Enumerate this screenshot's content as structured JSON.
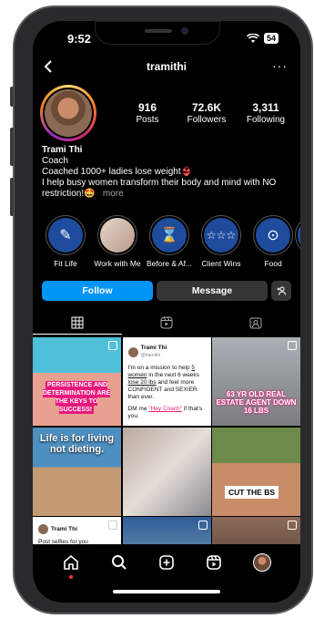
{
  "status_bar": {
    "time": "9:52",
    "battery": "54"
  },
  "header": {
    "username": "tramithi"
  },
  "profile": {
    "stats": [
      {
        "value": "916",
        "label": "Posts"
      },
      {
        "value": "72.6K",
        "label": "Followers"
      },
      {
        "value": "3,311",
        "label": "Following"
      }
    ],
    "name": "Trami Thi",
    "category": "Coach",
    "bio_line1": "Coached 1000+ ladies lose weight👙",
    "bio_line2": "I help busy women transform their body and mind with NO restriction!🤩",
    "more_label": "more"
  },
  "highlights": [
    {
      "label": "Fit Life",
      "icon": "weightlifter-icon",
      "color": "#1e4b9c"
    },
    {
      "label": "Work with Me",
      "icon": "photo-woman",
      "color": "#e6d6cc"
    },
    {
      "label": "Before & Af...",
      "icon": "body-icon",
      "color": "#1e4b9c"
    },
    {
      "label": "Client Wins",
      "icon": "chat-stars-icon",
      "color": "#1e4b9c"
    },
    {
      "label": "Food",
      "icon": "plate-icon",
      "color": "#1e4b9c"
    }
  ],
  "actions": {
    "follow": "Follow",
    "message": "Message",
    "add_user": "+ᕱ"
  },
  "grid": {
    "c1_caption": "PERSISTENCE AND DETERMINATION ARE THE KEYS TO SUCCESS!",
    "c2_author": "Trami Thi",
    "c2_handle": "@tramithi",
    "c2_text_1": "I'm on a mission to help",
    "c2_text_u1": "5 women",
    "c2_text_2": "in the next 6 weeks",
    "c2_text_u2": "lose 20 lbs",
    "c2_text_3": "and feel more CONFIDENT and SEXIER than ever.",
    "c2_text_4": "DM me",
    "c2_text_pink": "\"Hey Coach\"",
    "c2_text_5": "if that's you.",
    "c3_caption": "63 YR OLD REAL ESTATE AGENT DOWN 16 LBS",
    "c4_caption": "Life is for living not dieting.",
    "c6_caption": "CUT THE BS",
    "c7_author": "Trami Thi",
    "c7_text": "Post selfies for you"
  },
  "colors": {
    "accent": "#0095f6",
    "button_dark": "#363636",
    "highlight_pink": "#e8197c"
  }
}
